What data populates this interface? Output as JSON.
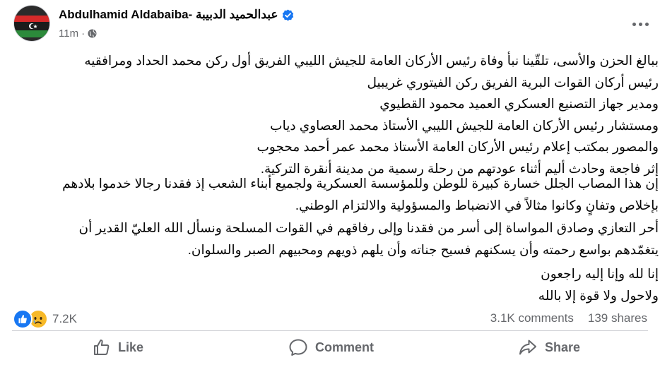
{
  "post": {
    "author": "Abdulhamid Aldabaiba- عبدالحميد الدبيبة",
    "time": "11m",
    "separator": "·",
    "paragraphs": [
      [
        "ببالغ الحزن والأسى، تلقّينا نبأ وفاة رئيس الأركان العامة للجيش الليبي الفريق أول ركن محمد الحداد ومرافقيه",
        "رئيس أركان القوات البرية الفريق ركن الفيتوري غريبيل",
        "ومدير جهاز التصنيع العسكري العميد  محمود القطيوي",
        "ومستشار رئيس الأركان العامة للجيش الليبي الأستاذ محمد العصاوي دياب",
        "والمصور بمكتب إعلام رئيس الأركان العامة الأستاذ محمد عمر أحمد محجوب",
        "إثر فاجعة وحادث أليم أثناء عودتهم من رحلة رسمية من مدينة أنقرة التركية."
      ],
      [
        "إن هذا المصاب الجلل خسارة كبيرة للوطن وللمؤسسة العسكرية ولجميع أبناء الشعب إذ فقدنا رجالا خدموا بلادهم",
        "بإخلاص وتفانٍ وكانوا مثالاً في الانضباط والمسؤولية والالتزام الوطني."
      ],
      [
        "أحر التعازي وصادق المواساة إلى أسر من فقدنا وإلى رفاقهم في القوات المسلحة ونسأل الله العليّ القدير أن",
        "يتغمّدهم بواسع رحمته وأن يسكنهم فسيح جناته وأن يلهم ذويهم ومحبيهم الصبر والسلوان."
      ],
      [
        "إنا لله وإنا إليه راجعون",
        "ولاحول ولا قوة إلا بالله"
      ]
    ]
  },
  "stats": {
    "reactions_count": "7.2K",
    "comments": "3.1K comments",
    "shares": "139 shares"
  },
  "actions": {
    "like": "Like",
    "comment": "Comment",
    "share": "Share"
  },
  "icons": {
    "verified": "verified-badge-icon",
    "globe": "globe-icon",
    "more": "more-options-icon",
    "like_reaction": "like-reaction-icon",
    "sad_reaction": "sad-reaction-icon",
    "like_action": "thumbs-up-icon",
    "comment_action": "comment-bubble-icon",
    "share_action": "share-arrow-icon"
  },
  "colors": {
    "verified": "#1877f2",
    "secondary_text": "#65676b",
    "like_reaction": "#1877f2",
    "sad_reaction": "#f7b928"
  }
}
